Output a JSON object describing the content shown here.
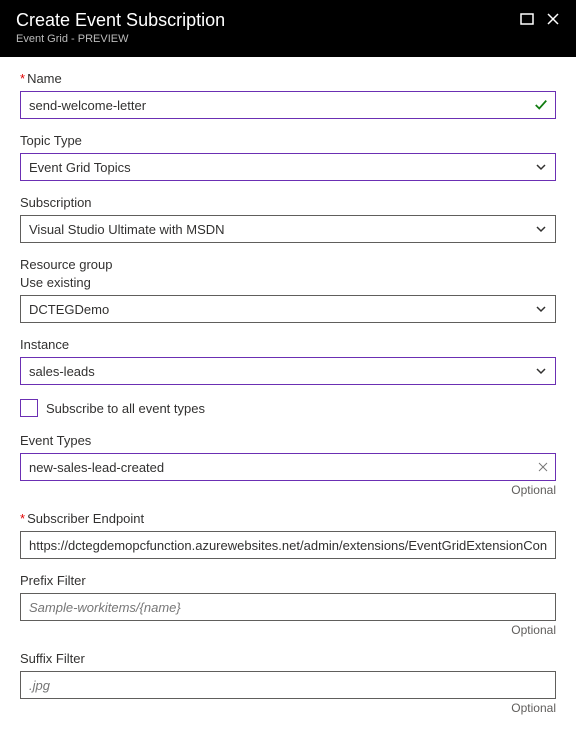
{
  "header": {
    "title": "Create Event Subscription",
    "subtitle": "Event Grid - PREVIEW"
  },
  "fields": {
    "name": {
      "label": "Name",
      "value": "send-welcome-letter"
    },
    "topicType": {
      "label": "Topic Type",
      "value": "Event Grid Topics"
    },
    "subscription": {
      "label": "Subscription",
      "value": "Visual Studio Ultimate with MSDN"
    },
    "resourceGroup": {
      "label": "Resource group",
      "sublabel": "Use existing",
      "value": "DCTEGDemo"
    },
    "instance": {
      "label": "Instance",
      "value": "sales-leads"
    },
    "subscribeAll": {
      "label": "Subscribe to all event types"
    },
    "eventTypes": {
      "label": "Event Types",
      "value": "new-sales-lead-created",
      "optional": "Optional"
    },
    "subscriberEndpoint": {
      "label": "Subscriber Endpoint",
      "value": "https://dctegdemopcfunction.azurewebsites.net/admin/extensions/EventGridExtensionConfig?fur"
    },
    "prefixFilter": {
      "label": "Prefix Filter",
      "placeholder": "Sample-workitems/{name}",
      "optional": "Optional"
    },
    "suffixFilter": {
      "label": "Suffix Filter",
      "placeholder": ".jpg",
      "optional": "Optional"
    }
  }
}
